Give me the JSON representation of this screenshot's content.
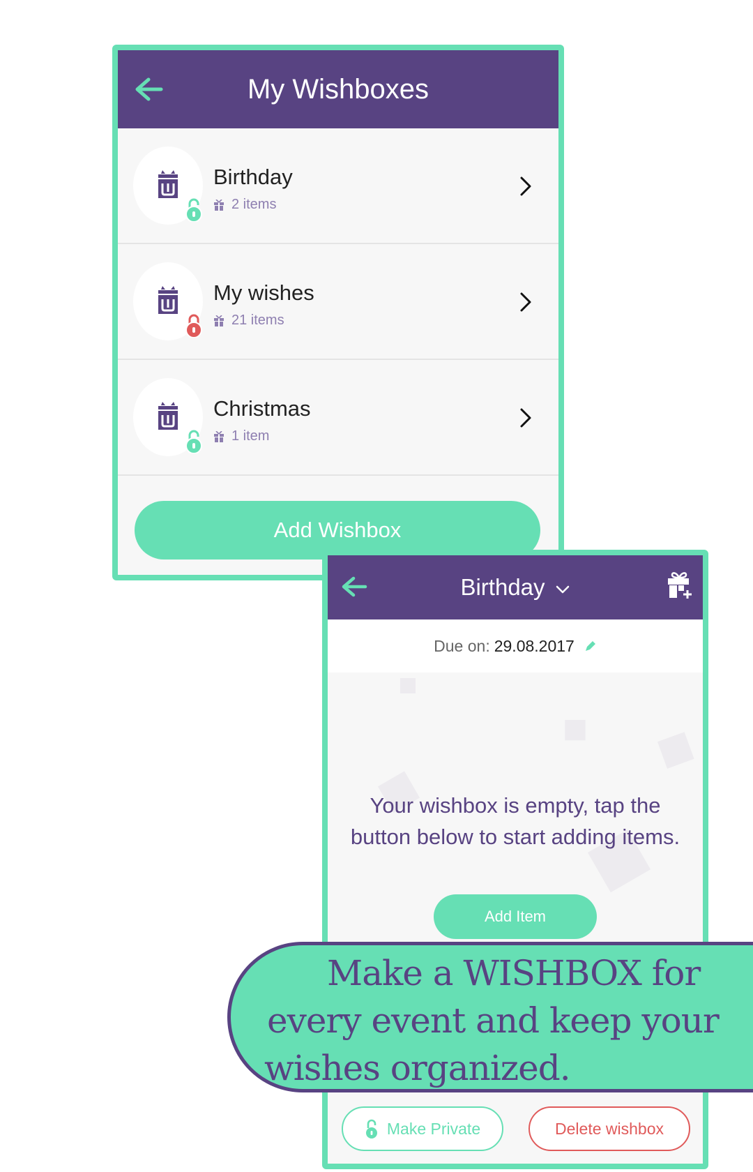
{
  "colors": {
    "primary_purple": "#584382",
    "accent_green": "#66dfb4",
    "lock_open": "#66dfb4",
    "lock_closed": "#e05a5a",
    "danger": "#e05a5a"
  },
  "screen1": {
    "back_icon": "arrow-left-icon",
    "title": "My Wishboxes",
    "wishboxes": [
      {
        "name": "Birthday",
        "count": "2 items",
        "lock": "unlocked"
      },
      {
        "name": "My wishes",
        "count": "21 items",
        "lock": "locked"
      },
      {
        "name": "Christmas",
        "count": "1 item",
        "lock": "unlocked"
      }
    ],
    "add_button": "Add Wishbox"
  },
  "screen2": {
    "back_icon": "arrow-left-icon",
    "title": "Birthday",
    "add_gift_icon": "add-gift-icon",
    "due_label": "Due on:",
    "due_date": "29.08.2017",
    "empty_message": "Your wishbox is empty, tap the button below to start adding items.",
    "add_item_button": "Add Item",
    "make_private_button": "Make Private",
    "delete_button": "Delete wishbox"
  },
  "banner": {
    "line1": "Make a WISHBOX for",
    "line2": "every event and keep your",
    "line3": "wishes organized."
  }
}
